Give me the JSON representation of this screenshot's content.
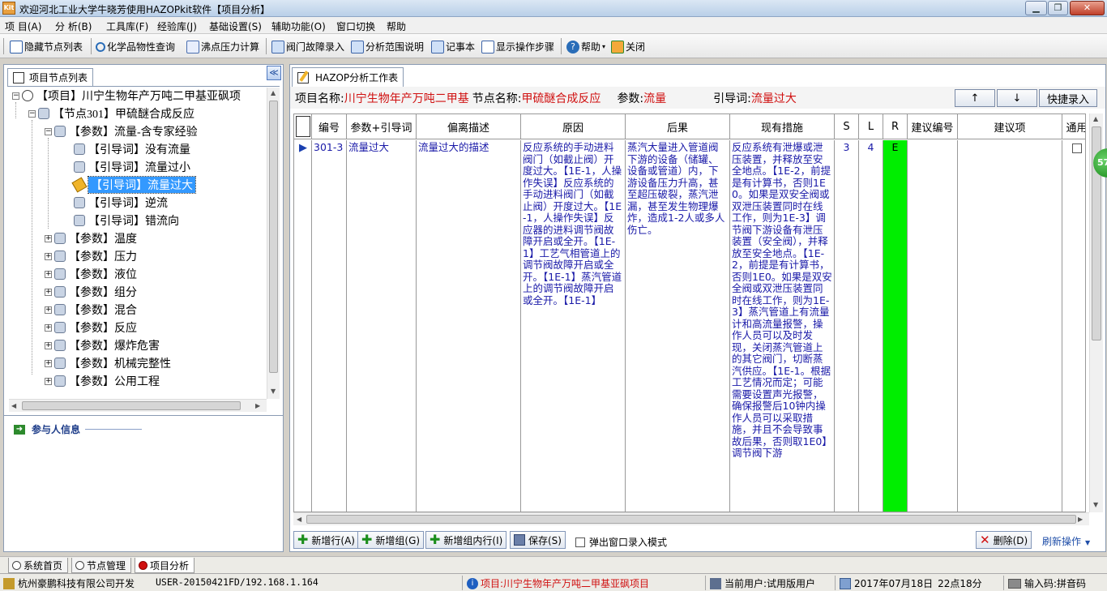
{
  "window": {
    "title": "欢迎河北工业大学牛晓芳使用HAZOPkit软件【项目分析】",
    "app_icon_text": "Kit"
  },
  "menu": [
    {
      "label": "项 目(A)"
    },
    {
      "label": "分 析(B)"
    },
    {
      "label": "工具库(F)"
    },
    {
      "label": "经验库(J)"
    },
    {
      "label": "基础设置(S)"
    },
    {
      "label": "辅助功能(O)"
    },
    {
      "label": "窗口切换"
    },
    {
      "label": "帮助"
    }
  ],
  "toolbar": {
    "hide_tree": "隐藏节点列表",
    "chem_query": "化学品物性查询",
    "boiling_calc": "沸点压力计算",
    "valve_fault": "阀门故障录入",
    "scope_desc": "分析范围说明",
    "notepad": "记事本",
    "show_steps": "显示操作步骤",
    "help": "帮助",
    "close": "关闭"
  },
  "left_panel": {
    "tab_label": "项目节点列表",
    "collapse_glyph": "≪",
    "tree": [
      {
        "label": "【项目】川宁生物年产万吨二甲基亚砜项",
        "level": 0,
        "expander": "−"
      },
      {
        "label": "【节点301】甲硫醚合成反应",
        "level": 1,
        "expander": "−"
      },
      {
        "label": "【参数】流量-含专家经验",
        "level": 2,
        "expander": "−"
      },
      {
        "label": "【引导词】没有流量",
        "level": 3
      },
      {
        "label": "【引导词】流量过小",
        "level": 3
      },
      {
        "label": "【引导词】流量过大",
        "level": 3,
        "selected": true
      },
      {
        "label": "【引导词】逆流",
        "level": 3
      },
      {
        "label": "【引导词】错流向",
        "level": 3
      },
      {
        "label": "【参数】温度",
        "level": 2,
        "expander": "+"
      },
      {
        "label": "【参数】压力",
        "level": 2,
        "expander": "+"
      },
      {
        "label": "【参数】液位",
        "level": 2,
        "expander": "+"
      },
      {
        "label": "【参数】组分",
        "level": 2,
        "expander": "+"
      },
      {
        "label": "【参数】混合",
        "level": 2,
        "expander": "+"
      },
      {
        "label": "【参数】反应",
        "level": 2,
        "expander": "+"
      },
      {
        "label": "【参数】爆炸危害",
        "level": 2,
        "expander": "+"
      },
      {
        "label": "【参数】机械完整性",
        "level": 2,
        "expander": "+"
      },
      {
        "label": "【参数】公用工程",
        "level": 2,
        "expander": "+"
      }
    ],
    "participants_label": "参与人信息"
  },
  "right_panel": {
    "tab_label": "HAZOP分析工作表",
    "project_name_label": "项目名称:",
    "project_name_value": "川宁生物年产万吨二甲基",
    "node_name_label": "节点名称:",
    "node_name_value": "甲硫醚合成反应",
    "param_label": "参数:",
    "param_value": "流量",
    "guideword_label": "引导词:",
    "guideword_value": "流量过大",
    "up_btn": "↑",
    "down_btn": "↓",
    "quick_entry": "快捷录入",
    "grid": {
      "columns": [
        "编号",
        "参数+引导词",
        "偏离描述",
        "原因",
        "后果",
        "现有措施",
        "S",
        "L",
        "R",
        "建议编号",
        "建议项",
        "通用"
      ],
      "row": {
        "indicator": "▶",
        "id": "301-3",
        "param_guide": "流量过大",
        "deviation": "流量过大的描述",
        "cause": "反应系统的手动进料阀门（如截止阀）开度过大。【1E-1，人操作失误】反应系统的手动进料阀门（如截止阀）开度过大。【1E-1，人操作失误】反应器的进料调节阀故障开启或全开。【1E-1】工艺气相管道上的调节阀故障开启或全开。【1E-1】蒸汽管道上的调节阀故障开启或全开。【1E-1】",
        "consequence": "蒸汽大量进入管道阀下游的设备（储罐、设备或管道）内，下游设备压力升高，甚至超压破裂，蒸汽泄漏，甚至发生物理爆炸，造成1-2人或多人伤亡。",
        "measures": "反应系统有泄爆或泄压装置，并释放至安全地点。【1E-2，前提是有计算书，否则1E0。如果是双安全阀或双泄压装置同时在线工作，则为1E-3】调节阀下游设备有泄压装置（安全阀），并释放至安全地点。【1E-2，前提是有计算书，否则1E0。如果是双安全阀或双泄压装置同时在线工作，则为1E-3】蒸汽管道上有流量计和高流量报警，操作人员可以及时发现，关闭蒸汽管道上的其它阀门，切断蒸汽供应。【1E-1。根据工艺情况而定；可能需要设置声光报警，确保报警后10钟内操作人员可以采取措施，并且不会导致事故后果，否则取1E0】调节阀下游",
        "s": "3",
        "l": "4",
        "r": "E",
        "suggestion_id": "",
        "suggestion": ""
      }
    },
    "actions": {
      "add_row": "新增行(A)",
      "add_group": "新增组(G)",
      "add_in_group": "新增组内行(I)",
      "save": "保存(S)",
      "popup_mode": "弹出窗口录入模式",
      "delete": "删除(D)",
      "refresh": "刷新操作"
    }
  },
  "float_badge": "57",
  "module_tabs": [
    {
      "label": "系统首页",
      "active": false
    },
    {
      "label": "节点管理",
      "active": false
    },
    {
      "label": "项目分析",
      "active": true
    }
  ],
  "status": {
    "company": "杭州豪鹏科技有限公司开发",
    "host": "USER-20150421FD/192.168.1.164",
    "project": "项目:川宁生物年产万吨二甲基亚砜项目",
    "user": "当前用户:试用版用户",
    "date": "2017年07月18日",
    "time": "22点18分",
    "input_method": "输入码:拼音码"
  },
  "colors": {
    "accent_red": "#d01010",
    "cell_text_blue": "#1a1aa8",
    "risk_green": "#00ee00",
    "panel_border": "#8a9bb3"
  }
}
